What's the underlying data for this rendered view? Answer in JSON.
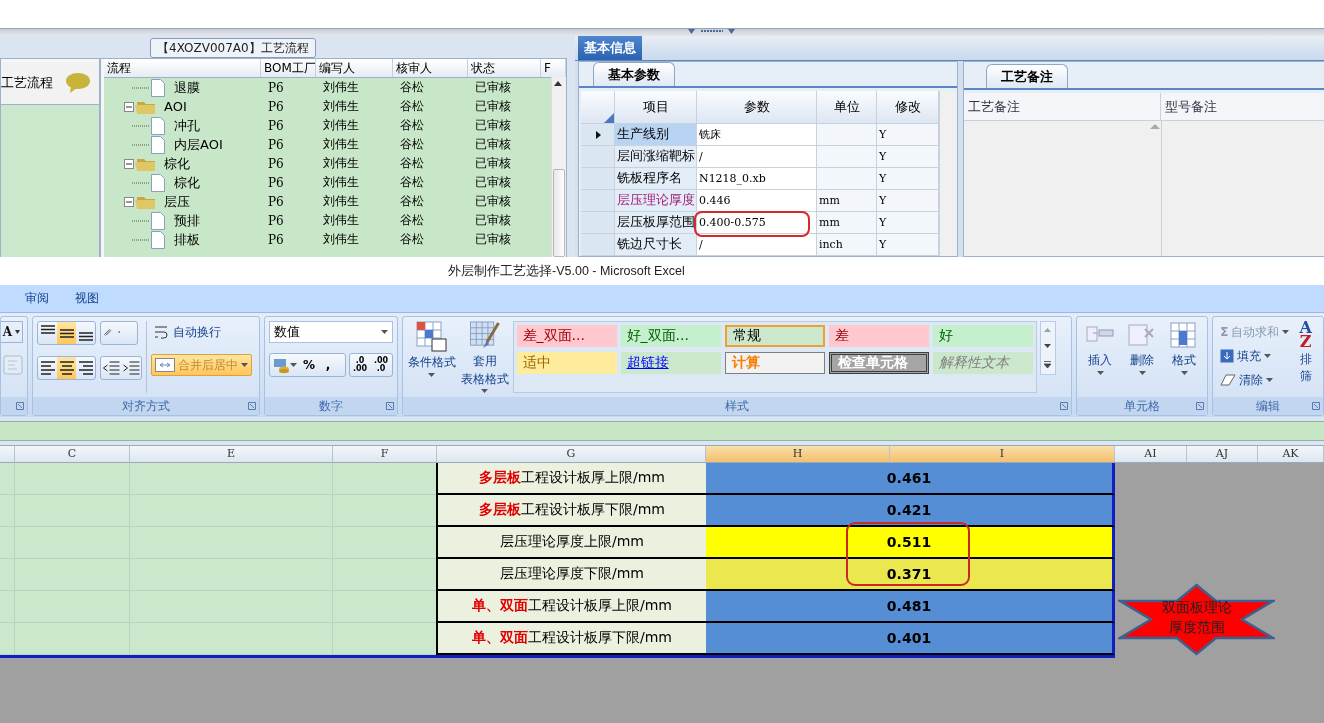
{
  "flow_panel": {
    "title": "【4XOZV007A0】工艺流程",
    "nav_label": "工艺流程",
    "columns": [
      "流程",
      "BOM工厂",
      "编写人",
      "核审人",
      "状态",
      "F"
    ],
    "tree": [
      {
        "kind": "offscreen",
        "children": [
          {
            "kind": "file",
            "label": "退膜",
            "cells": [
              "P6",
              "刘伟生",
              "谷松",
              "已审核"
            ]
          }
        ]
      },
      {
        "kind": "folder",
        "label": "AOI",
        "expanded": true,
        "cells": [
          "P6",
          "刘伟生",
          "谷松",
          "已审核"
        ],
        "children": [
          {
            "kind": "file",
            "label": "冲孔",
            "cells": [
              "P6",
              "刘伟生",
              "谷松",
              "已审核"
            ]
          },
          {
            "kind": "file",
            "label": "内层AOI",
            "cells": [
              "P6",
              "刘伟生",
              "谷松",
              "已审核"
            ]
          }
        ]
      },
      {
        "kind": "folder",
        "label": "棕化",
        "expanded": true,
        "cells": [
          "P6",
          "刘伟生",
          "谷松",
          "已审核"
        ],
        "children": [
          {
            "kind": "file",
            "label": "棕化",
            "cells": [
              "P6",
              "刘伟生",
              "谷松",
              "已审核"
            ]
          }
        ]
      },
      {
        "kind": "folder",
        "label": "层压",
        "expanded": true,
        "cells": [
          "P6",
          "刘伟生",
          "谷松",
          "已审核"
        ],
        "children": [
          {
            "kind": "file",
            "label": "预排",
            "cells": [
              "P6",
              "刘伟生",
              "谷松",
              "已审核"
            ]
          },
          {
            "kind": "file",
            "label": "排板",
            "cells": [
              "P6",
              "刘伟生",
              "谷松",
              "已审核"
            ]
          }
        ]
      }
    ]
  },
  "info_panel": {
    "tab": "基本信息",
    "params": {
      "tab": "基本参数",
      "columns": [
        "项目",
        "参数",
        "单位",
        "修改"
      ],
      "rows": [
        {
          "item": "生产线别",
          "value": "铣床",
          "modified": "Y",
          "selected": true,
          "emphasized": false
        },
        {
          "item": "层间涨缩靶标",
          "value": "/",
          "modified": "Y",
          "selected": false,
          "emphasized": false
        },
        {
          "item": "铣板程序名",
          "value": "N1218_0.xb",
          "modified": "Y",
          "selected": false,
          "emphasized": false
        },
        {
          "item": "层压理论厚度",
          "value": "0.446",
          "unit": "mm",
          "modified": "Y",
          "selected": false,
          "emphasized": true
        },
        {
          "item": "层压板厚范围",
          "value": "0.400-0.575",
          "unit": "mm",
          "modified": "Y",
          "selected": false,
          "emphasized": false
        },
        {
          "item": "铣边尺寸长",
          "value": "/",
          "unit": "inch",
          "modified": "Y",
          "selected": false,
          "emphasized": false
        }
      ]
    },
    "notes": {
      "tab": "工艺备注",
      "columns": [
        "工艺备注",
        "型号备注"
      ]
    }
  },
  "excel": {
    "title": "外层制作工艺选择-V5.00 - Microsoft Excel",
    "ribbon_tabs": [
      "审阅",
      "视图"
    ],
    "font_group": {
      "grow_button": "A"
    },
    "alignment": {
      "vertical": [
        {
          "kind": "top",
          "selected": false
        },
        {
          "kind": "middle",
          "selected": true
        },
        {
          "kind": "bottom",
          "selected": false
        }
      ],
      "horizontal": [
        {
          "kind": "left",
          "selected": false
        },
        {
          "kind": "center",
          "selected": true
        },
        {
          "kind": "right",
          "selected": false
        }
      ],
      "wrap_text": "自动换行",
      "merge_center": {
        "label": "合并后居中",
        "selected": true
      },
      "label": "对齐方式"
    },
    "number": {
      "format": "数值",
      "percent": "%",
      "comma": ",",
      "decimals": [
        [
          ".0",
          ".00"
        ],
        [
          ".00",
          ".0"
        ]
      ],
      "label": "数字"
    },
    "styles": {
      "conditional": "条件格式",
      "table_format": [
        "套用",
        "表格格式"
      ],
      "swatches": [
        {
          "label": "差_双面...",
          "kind": "bad",
          "selected": false
        },
        {
          "label": "好_双面...",
          "kind": "good",
          "selected": false
        },
        {
          "label": "常规",
          "kind": "normal",
          "selected": true
        },
        {
          "label": "差",
          "kind": "bad",
          "selected": false
        },
        {
          "label": "好",
          "kind": "good",
          "selected": false
        },
        {
          "label": "适中",
          "kind": "neutral",
          "selected": false
        },
        {
          "label": "超链接",
          "kind": "hyperlink",
          "selected": false
        },
        {
          "label": "计算",
          "kind": "calculation",
          "selected": false
        },
        {
          "label": "检查单元格",
          "kind": "check",
          "selected": false
        },
        {
          "label": "解释性文本",
          "kind": "explanatory",
          "selected": false
        }
      ],
      "label": "样式"
    },
    "cells": {
      "buttons": [
        "插入",
        "删除",
        "格式"
      ],
      "label": "单元格"
    },
    "editing": {
      "autosum": {
        "symbol": "Σ",
        "label": "自动求和",
        "disabled": true
      },
      "fill": "填充",
      "clear": "清除",
      "sort": {
        "letters": [
          "A",
          "Z"
        ],
        "lines": [
          "排",
          "筛"
        ]
      },
      "label": "编辑"
    }
  },
  "sheet": {
    "columns": [
      {
        "label": "C",
        "selected": false
      },
      {
        "label": "E",
        "selected": false
      },
      {
        "label": "F",
        "selected": false
      },
      {
        "label": "G",
        "selected": false
      },
      {
        "label": "H",
        "selected": true
      },
      {
        "label": "I",
        "selected": true
      },
      {
        "label": "AI",
        "selected": false
      },
      {
        "label": "AJ",
        "selected": false
      },
      {
        "label": "AK",
        "selected": false
      }
    ],
    "rows": [
      {
        "label": "**多层板**工程设计板厚上限/mm",
        "value": "0.461",
        "color": "#558ed5"
      },
      {
        "label": "**多层板**工程设计板厚下限/mm",
        "value": "0.421",
        "color": "#558ed5"
      },
      {
        "label": "层压理论厚度上限/mm",
        "value": "0.511",
        "color": "#ffff00"
      },
      {
        "label": "层压理论厚度下限/mm",
        "value": "0.371",
        "color": "#ebe84f"
      },
      {
        "label": "**单、双面**工程设计板厚上限/mm",
        "value": "0.481",
        "color": "#558ed5"
      },
      {
        "label": "**单、双面**工程设计板厚下限/mm",
        "value": "0.401",
        "color": "#558ed5"
      }
    ],
    "shape": {
      "text": "双面板理论厚度范围"
    }
  }
}
